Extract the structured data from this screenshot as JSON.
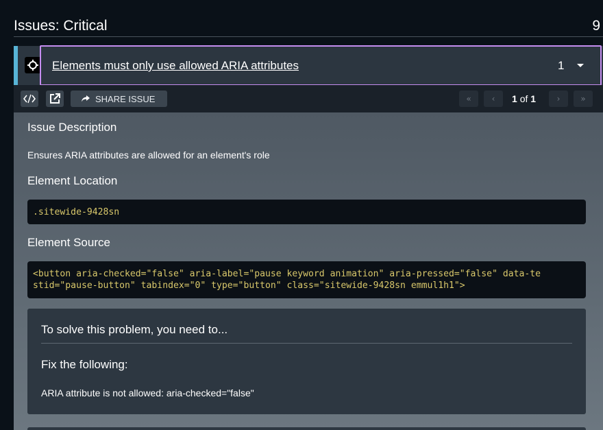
{
  "header": {
    "title": "Issues: Critical",
    "count": "9"
  },
  "issue": {
    "title": "Elements must only use allowed ARIA attributes",
    "count": "1",
    "accent_color": "#58b4d6",
    "focus_color": "#c58df0"
  },
  "toolbar": {
    "code_icon": "code-icon",
    "open_icon": "external-link-icon",
    "share_label": "SHARE ISSUE",
    "pager_current": "1",
    "pager_of": "of",
    "pager_total": "1"
  },
  "details": {
    "description_heading": "Issue Description",
    "description": "Ensures ARIA attributes are allowed for an element's role",
    "location_heading": "Element Location",
    "location": ".sitewide-9428sn",
    "source_heading": "Element Source",
    "source_line1": "<button aria-checked=\"false\" aria-label=\"pause keyword animation\" aria-pressed=\"false\" data-te",
    "source_line2": "stid=\"pause-button\" tabindex=\"0\" type=\"button\" class=\"sitewide-9428sn emmul1h1\">"
  },
  "fix": {
    "title": "To solve this problem, you need to...",
    "subtitle": "Fix the following:",
    "message": "ARIA attribute is not allowed: aria-checked=\"false\""
  }
}
